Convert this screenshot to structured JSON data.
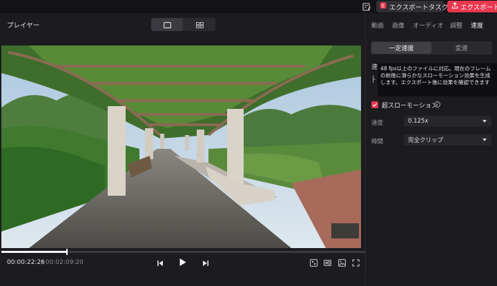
{
  "topbar": {
    "export_task_label": "エクスポートタスク",
    "export_label": "エクスポート"
  },
  "player": {
    "title": "プレイヤー",
    "current_time": "00:00:22:26",
    "total_time": "/ 00:02:09:20",
    "progress_fraction": 0.18
  },
  "panel": {
    "tabs": [
      {
        "label": "動画"
      },
      {
        "label": "画像"
      },
      {
        "label": "オーディオ"
      },
      {
        "label": "調整"
      },
      {
        "label": "速度"
      }
    ],
    "speed_modes": [
      {
        "label": "一定速度"
      },
      {
        "label": "変速"
      }
    ],
    "tooltip": "48 fps以上のファイルに対応。現在のフレームの前後に滑らかなスローモーション効果を生成します。エクスポート後に効果を確認できます",
    "slowmo_label": "超スローモーション",
    "speed_label": "速度",
    "speed_value": "0.125x",
    "time_label": "時間",
    "time_value": "完全クリップ",
    "accent_color": "#e8384f"
  }
}
